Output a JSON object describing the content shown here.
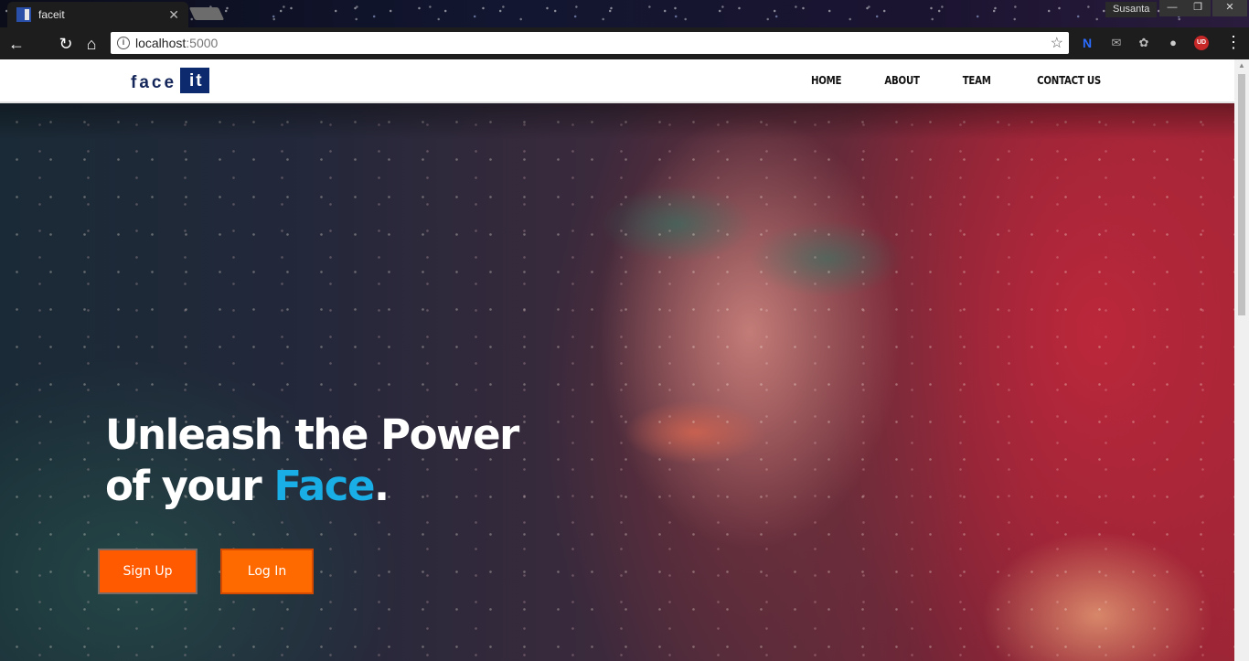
{
  "browser": {
    "tab": {
      "title": "faceit"
    },
    "profile_name": "Susanta",
    "address": {
      "host": "localhost",
      "port": ":5000"
    },
    "extensions": {
      "n_label": "N",
      "ud_label": "UD"
    }
  },
  "site": {
    "logo": {
      "face": "face",
      "it": "it"
    },
    "nav": [
      "HOME",
      "ABOUT",
      "TEAM",
      "CONTACT US"
    ]
  },
  "hero": {
    "headline_line1": "Unleash the Power",
    "headline_line2_prefix": "of your ",
    "headline_accent": "Face",
    "headline_suffix": ".",
    "accent_color": "#1aaee6",
    "signup_label": "Sign Up",
    "login_label": "Log In",
    "button_color": "#ff5a00"
  }
}
